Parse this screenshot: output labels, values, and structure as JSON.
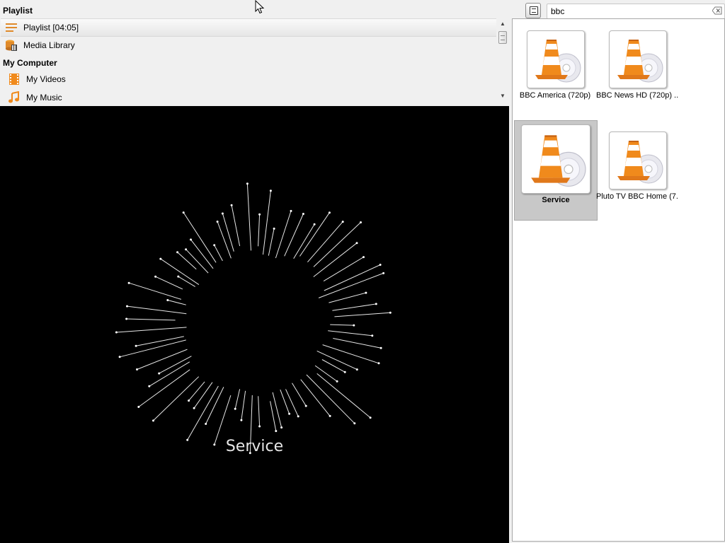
{
  "sidebar": {
    "playlist_header": "Playlist",
    "playlist_item": "Playlist [04:05]",
    "media_library": "Media Library",
    "computer_header": "My Computer",
    "my_videos": "My Videos",
    "my_music": "My Music"
  },
  "video": {
    "visualization_label": "Service"
  },
  "search": {
    "value": "bbc"
  },
  "grid": {
    "items": [
      {
        "label": "BBC America (720p)",
        "icon": "vlc-cone-icon"
      },
      {
        "label": "BBC News HD (720p) ...",
        "icon": "vlc-cone-icon"
      },
      {
        "label": "Service",
        "icon": "vlc-cone-icon",
        "selected": true
      },
      {
        "label": "Pluto TV BBC Home (7...",
        "icon": "vlc-cone-icon"
      }
    ]
  },
  "colors": {
    "video_background": "#000000",
    "pane_background": "#f0f0f0",
    "vlc_orange": "#f08a1c",
    "selection": "#c8c8c8"
  }
}
